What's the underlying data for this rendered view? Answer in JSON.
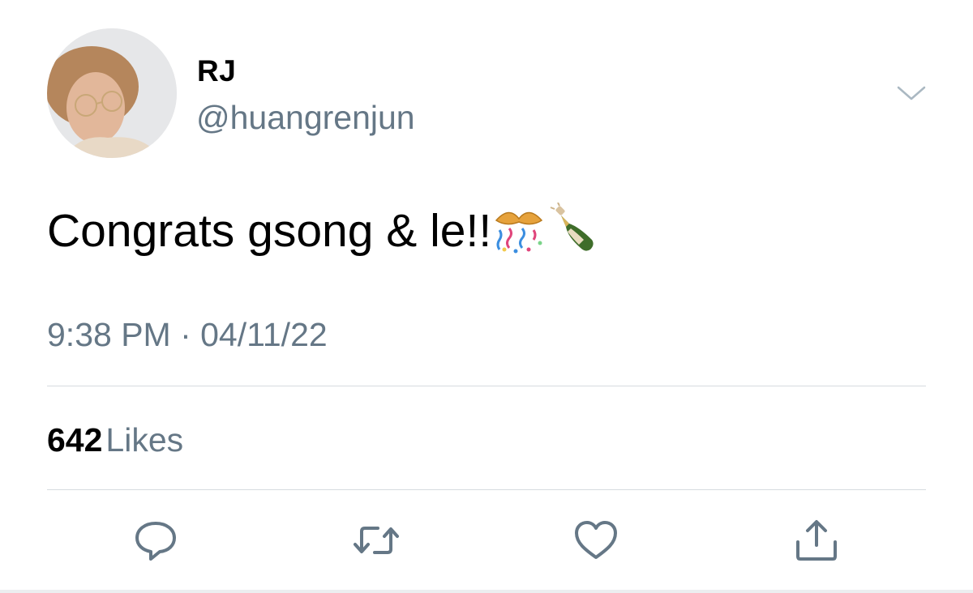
{
  "tweet": {
    "author": {
      "display_name": "RJ",
      "handle": "@huangrenjun"
    },
    "text": "Congrats gsong & le!!",
    "emojis": [
      "confetti-ball-emoji",
      "champagne-bottle-emoji"
    ],
    "timestamp": "9:38 PM · 04/11/22",
    "likes": {
      "count": "642",
      "label": "Likes"
    }
  },
  "icons": {
    "menu": "chevron-down-icon",
    "reply": "speech-bubble-icon",
    "retweet": "retweet-arrows-icon",
    "like": "heart-icon",
    "share": "share-upload-icon"
  },
  "colors": {
    "secondary_text": "#657786",
    "divider": "#d6dbdf",
    "icon": "#657786"
  }
}
